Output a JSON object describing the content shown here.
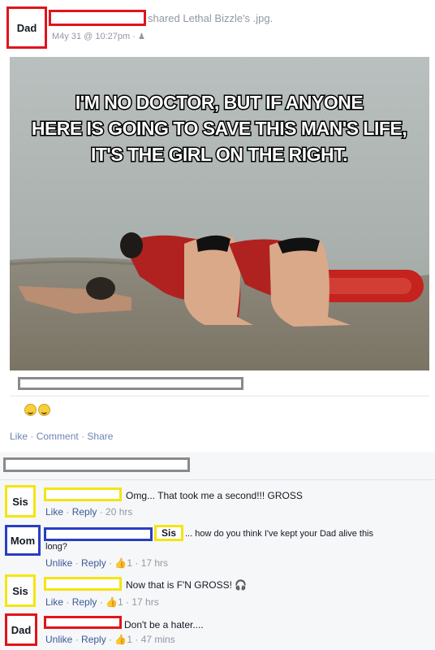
{
  "post": {
    "author_tag": "Dad",
    "action": "shared Lethal Bizzle's .jpg.",
    "timestamp": "M4y 31 @ 10:27pm ·",
    "meme_lines": [
      "I'M NO DOCTOR, BUT IF ANYONE",
      "HERE IS GOING TO SAVE THIS MAN'S LIFE,",
      "IT'S THE GIRL ON THE RIGHT."
    ],
    "actions": {
      "like": "Like",
      "comment": "Comment",
      "share": "Share"
    }
  },
  "comments": [
    {
      "tag": "Sis",
      "text": "Omg... That took me a second!!! GROSS",
      "like": "Like",
      "reply": "Reply",
      "time": "20 hrs"
    },
    {
      "tag": "Mom",
      "mention": "Sis",
      "text_line1": "... how do you think I've kept your Dad alive this",
      "text_line2": "long?",
      "like": "Unlike",
      "reply": "Reply",
      "likes": "1",
      "time": "17 hrs"
    },
    {
      "tag": "Sis",
      "text": "Now that is F'N GROSS!",
      "like": "Like",
      "reply": "Reply",
      "likes": "1",
      "time": "17 hrs"
    },
    {
      "tag": "Dad",
      "text": "Don't be a hater....",
      "like": "Unlike",
      "reply": "Reply",
      "likes": "1",
      "time": "47 mins"
    }
  ],
  "colors": {
    "dad": "#e0141b",
    "sis": "#f4e512",
    "mom": "#2a3ec2",
    "redacted": "#8a8a8a"
  }
}
